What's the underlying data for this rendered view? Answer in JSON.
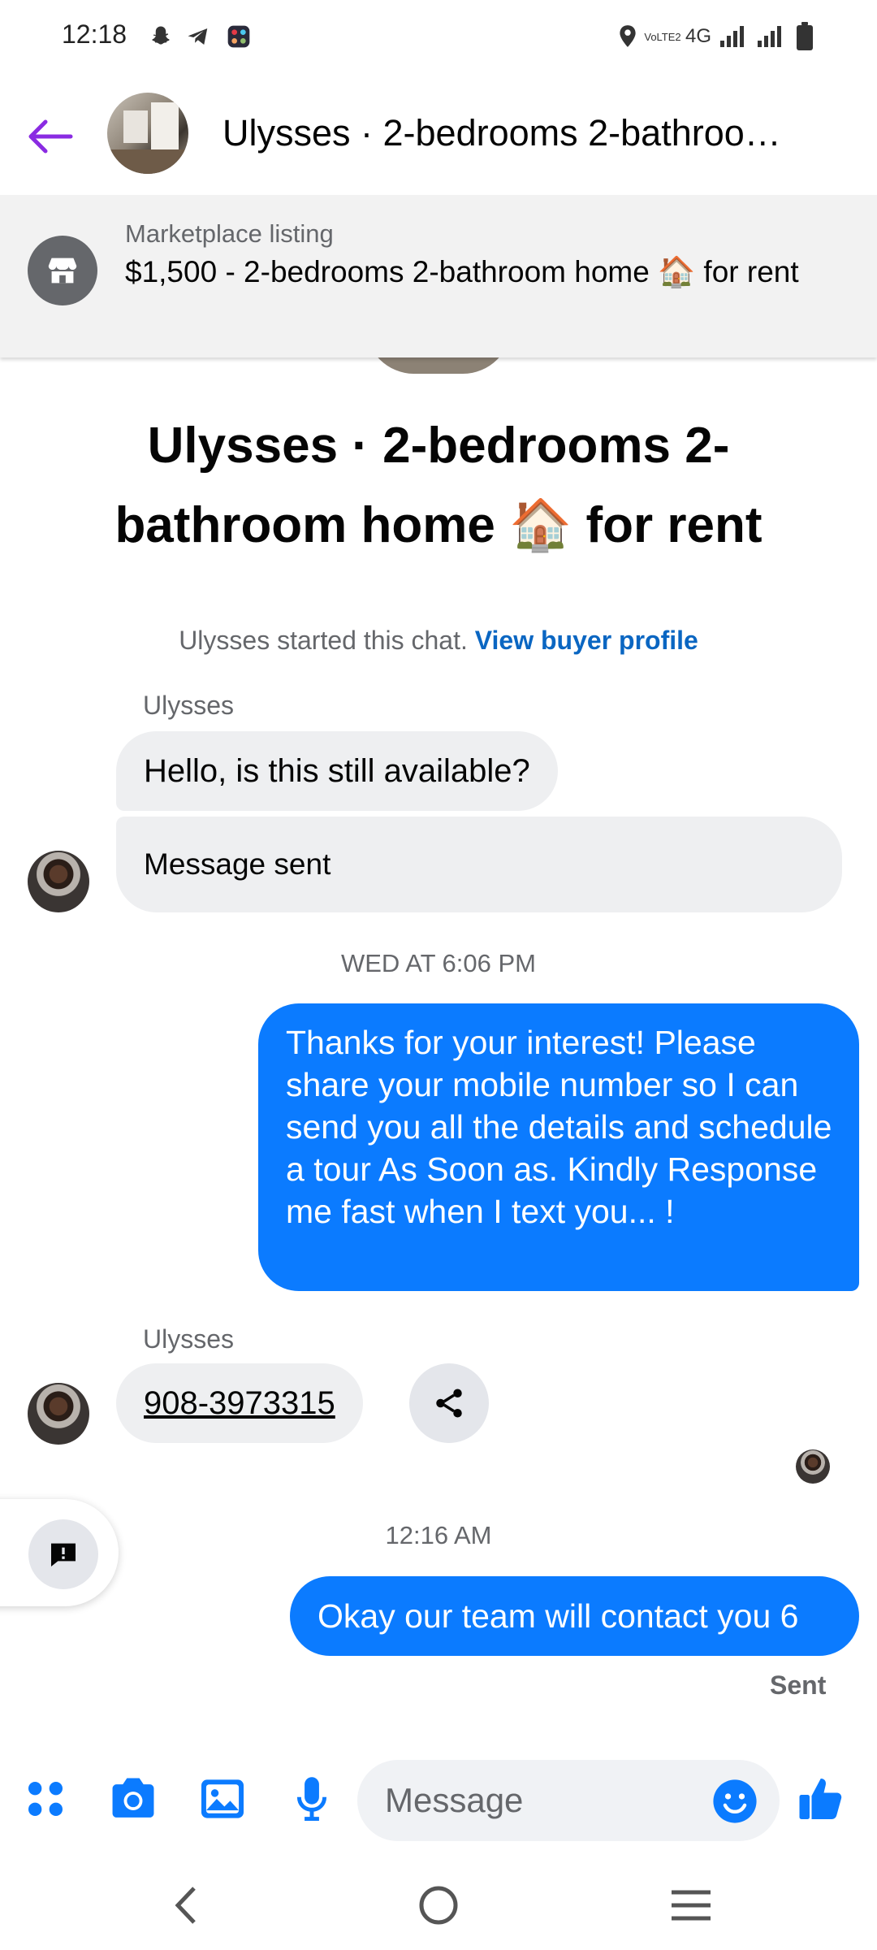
{
  "status_bar": {
    "time": "12:18",
    "network": "4G",
    "volte": "VoLTE2"
  },
  "header": {
    "title": "Ulysses · 2-bedrooms 2-bathroo…"
  },
  "listing": {
    "label": "Marketplace listing",
    "text": "$1,500 - 2-bedrooms 2-bathroom home 🏠 for rent"
  },
  "hero": {
    "title": "Ulysses · 2-bedrooms 2-bathroom home 🏠 for rent"
  },
  "chat": {
    "started_text": "Ulysses started this chat.",
    "view_profile_link": "View buyer profile",
    "sender_name_1": "Ulysses",
    "msg_in_1": "Hello, is this still available?",
    "msg_in_2": "Message sent",
    "timestamp_1": "WED AT 6:06 PM",
    "msg_out_1": "Thanks for your interest! Please share your mobile number so I can send you all the details and schedule a tour As Soon as. Kindly Response me fast when I text you... !",
    "sender_name_2": "Ulysses",
    "msg_in_phone": "908-3973315",
    "timestamp_2": "12:16 AM",
    "msg_out_2": "Okay our team will contact you 6",
    "status_sent": "Sent"
  },
  "composer": {
    "placeholder": "Message"
  },
  "colors": {
    "accent_blue": "#0b7bff",
    "back_arrow": "#8a2be2",
    "link_blue": "#0a66c2"
  },
  "icons": [
    "snapchat-icon",
    "telegram-icon",
    "app-icon",
    "location-icon",
    "signal-icon",
    "battery-icon",
    "back-arrow-icon",
    "store-icon",
    "share-icon",
    "report-icon",
    "apps-icon",
    "camera-icon",
    "gallery-icon",
    "mic-icon",
    "emoji-icon",
    "thumbs-up-icon",
    "nav-back-icon",
    "nav-home-icon",
    "nav-menu-icon"
  ]
}
